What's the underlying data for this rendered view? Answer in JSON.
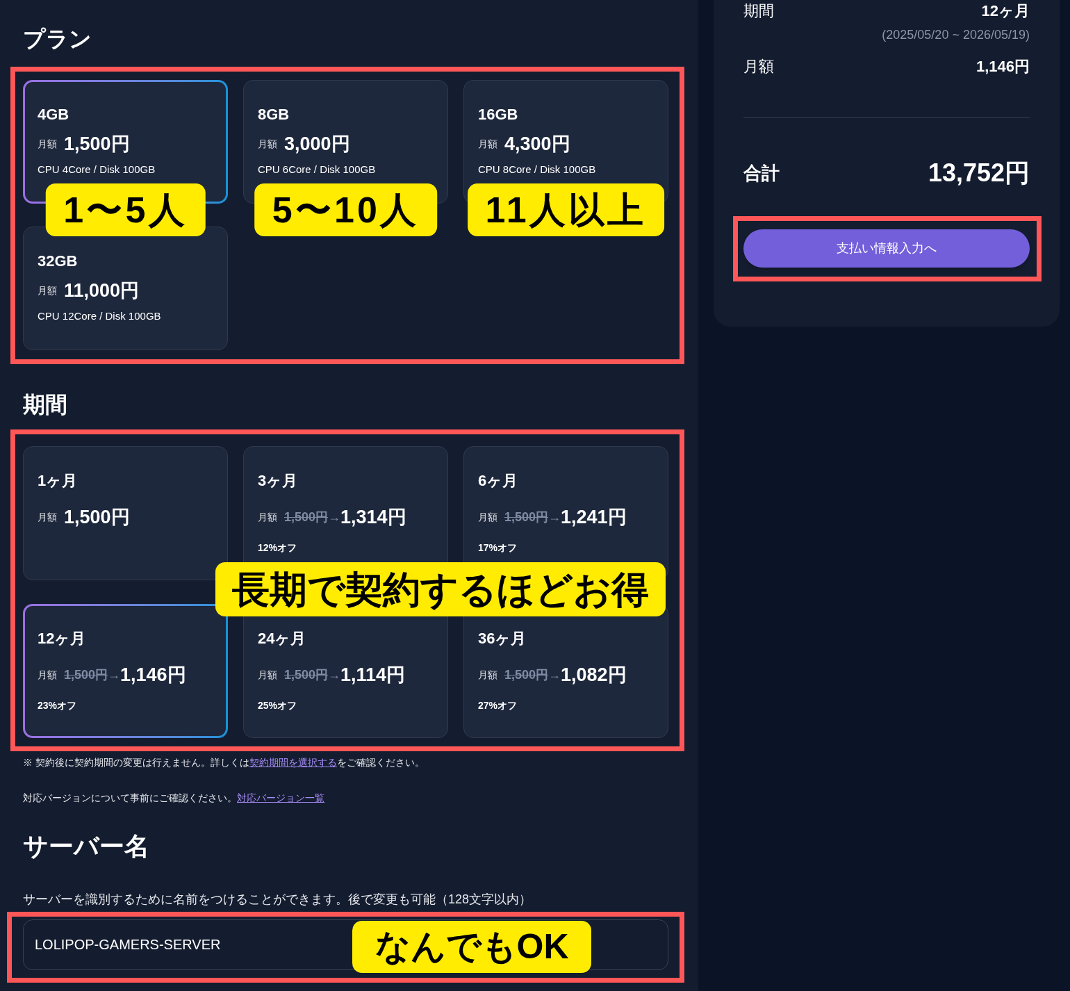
{
  "plan_section": {
    "heading": "プラン",
    "highlighted": true,
    "plans": [
      {
        "name": "4GB",
        "price_label": "月額",
        "price": "1,500円",
        "spec": "CPU 4Core / Disk 100GB",
        "selected": true,
        "callout": "1〜5人"
      },
      {
        "name": "8GB",
        "price_label": "月額",
        "price": "3,000円",
        "spec": "CPU 6Core / Disk 100GB",
        "selected": false,
        "callout": "5〜10人"
      },
      {
        "name": "16GB",
        "price_label": "月額",
        "price": "4,300円",
        "spec": "CPU 8Core / Disk 100GB",
        "selected": false,
        "callout": "11人以上"
      },
      {
        "name": "32GB",
        "price_label": "月額",
        "price": "11,000円",
        "spec": "CPU 12Core / Disk 100GB",
        "selected": false
      }
    ]
  },
  "period_section": {
    "heading": "期間",
    "highlighted": true,
    "callout": "長期で契約するほどお得",
    "periods": [
      {
        "name": "1ヶ月",
        "price_label": "月額",
        "price": "1,500円",
        "selected": false
      },
      {
        "name": "3ヶ月",
        "price_label": "月額",
        "original_price": "1,500円",
        "arrow": "→",
        "price": "1,314円",
        "discount": "12%オフ",
        "selected": false
      },
      {
        "name": "6ヶ月",
        "price_label": "月額",
        "original_price": "1,500円",
        "arrow": "→",
        "price": "1,241円",
        "discount": "17%オフ",
        "selected": false
      },
      {
        "name": "12ヶ月",
        "price_label": "月額",
        "original_price": "1,500円",
        "arrow": "→",
        "price": "1,146円",
        "discount": "23%オフ",
        "selected": true
      },
      {
        "name": "24ヶ月",
        "price_label": "月額",
        "original_price": "1,500円",
        "arrow": "→",
        "price": "1,114円",
        "discount": "25%オフ",
        "selected": false
      },
      {
        "name": "36ヶ月",
        "price_label": "月額",
        "original_price": "1,500円",
        "arrow": "→",
        "price": "1,082円",
        "discount": "27%オフ",
        "selected": false
      }
    ]
  },
  "notes": [
    {
      "text": "※ 契約後に契約期間の変更は行えません。詳しくは",
      "link": "契約期間を選択する",
      "text_after": "をご確認ください。"
    },
    {
      "text": "対応バージョンについて事前にご確認ください。",
      "link": "対応バージョン一覧"
    }
  ],
  "server_name": {
    "heading": "サーバー名",
    "description": "サーバーを識別するために名前をつけることができます。後で変更も可能（128文字以内）",
    "value": "LOLIPOP-GAMERS-SERVER",
    "highlighted": true,
    "callout": "なんでもOK"
  },
  "summary": {
    "rows": [
      {
        "label": "期間",
        "value": "12ヶ月",
        "detail": "(2025/05/20 ~ 2026/05/19)"
      },
      {
        "label": "月額",
        "value": "1,146円"
      }
    ],
    "total": {
      "label": "合計",
      "value": "13,752円"
    },
    "button": {
      "label": "支払い情報入力へ",
      "highlighted": true
    }
  }
}
